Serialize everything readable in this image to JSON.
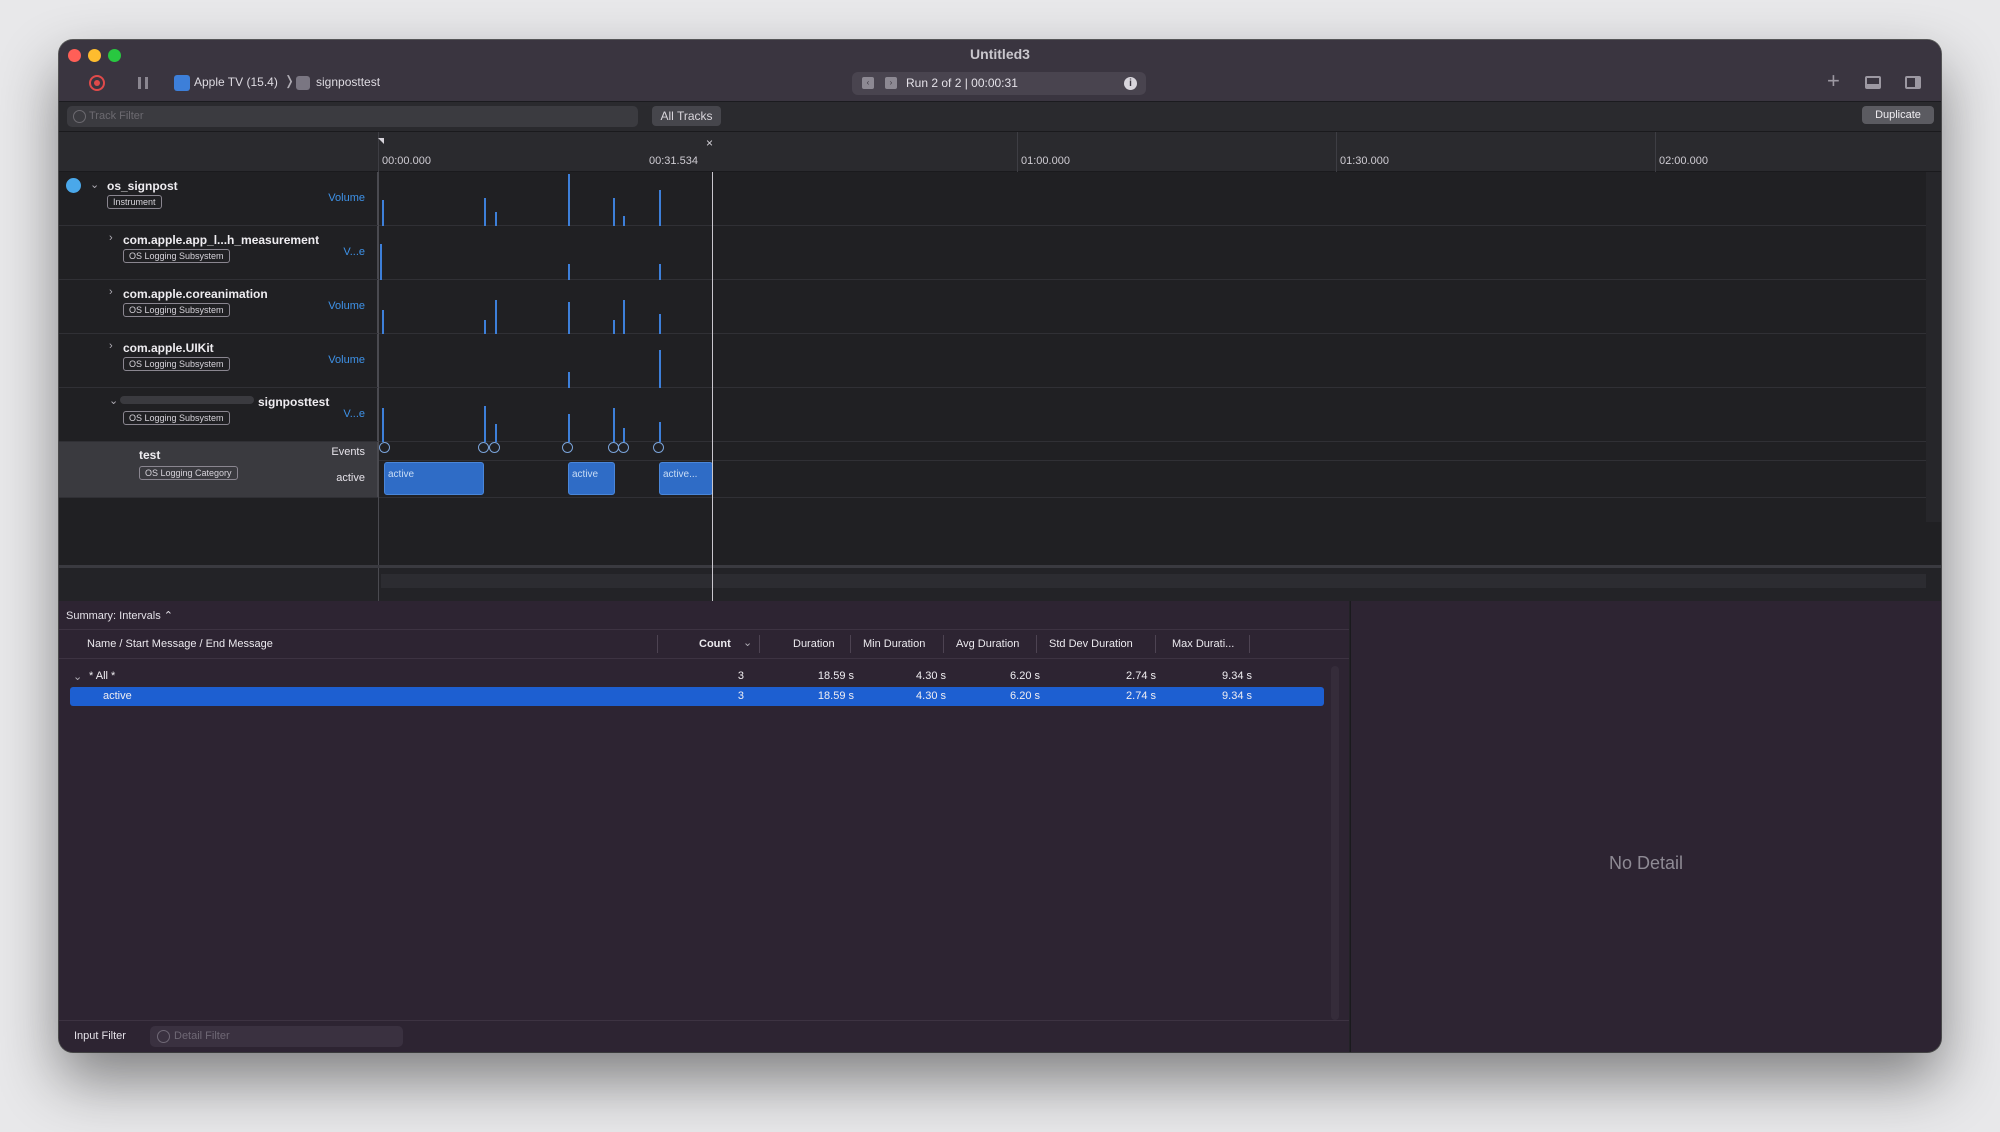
{
  "window": {
    "title": "Untitled3"
  },
  "toolbar": {
    "device_label": "Apple TV (15.4)",
    "crumb_separator": "❭",
    "app_label": "signposttest",
    "run_label": "Run 2 of 2  |  00:00:31",
    "prev_icon": "‹",
    "next_icon": "›",
    "info_icon": "i",
    "plus_icon": "+"
  },
  "filter_bar": {
    "track_filter_placeholder": "Track Filter",
    "all_tracks_label": "All Tracks",
    "duplicate_label": "Duplicate"
  },
  "timeline": {
    "ticks": [
      "00:00.000",
      "00:31.534",
      "01:00.000",
      "01:30.000",
      "02:00.000"
    ]
  },
  "tracks": [
    {
      "name": "os_signpost",
      "badge": "Instrument",
      "mode": "Volume"
    },
    {
      "name": "com.apple.app_l...h_measurement",
      "badge": "OS Logging Subsystem",
      "mode": "V...e"
    },
    {
      "name": "com.apple.coreanimation",
      "badge": "OS Logging Subsystem",
      "mode": "Volume"
    },
    {
      "name": "com.apple.UIKit",
      "badge": "OS Logging Subsystem",
      "mode": "Volume"
    },
    {
      "name": "signposttest",
      "badge": "OS Logging Subsystem",
      "mode": "V...e"
    },
    {
      "name": "test",
      "badge": "OS Logging Category",
      "mode_events": "Events",
      "mode_active": "active"
    }
  ],
  "intervals": [
    {
      "label": "active"
    },
    {
      "label": "active"
    },
    {
      "label": "active..."
    }
  ],
  "summary": {
    "label": "Summary: Intervals ⌃"
  },
  "table": {
    "headers": [
      "Name / Start Message / End Message",
      "Count",
      "Duration",
      "Min Duration",
      "Avg Duration",
      "Std Dev Duration",
      "Max Durati..."
    ],
    "rows": [
      {
        "name": "* All *",
        "count": "3",
        "duration": "18.59 s",
        "min": "4.30 s",
        "avg": "6.20 s",
        "std": "2.74 s",
        "max": "9.34 s"
      },
      {
        "name": "active",
        "count": "3",
        "duration": "18.59 s",
        "min": "4.30 s",
        "avg": "6.20 s",
        "std": "2.74 s",
        "max": "9.34 s"
      }
    ]
  },
  "detail": {
    "empty_label": "No Detail"
  },
  "input_bar": {
    "label": "Input Filter",
    "detail_filter_placeholder": "Detail Filter"
  },
  "colors": {
    "accent": "#1d5fd1",
    "interval": "#2f6cc6",
    "spike": "#3d7fd9",
    "record": "#e04a4a"
  }
}
